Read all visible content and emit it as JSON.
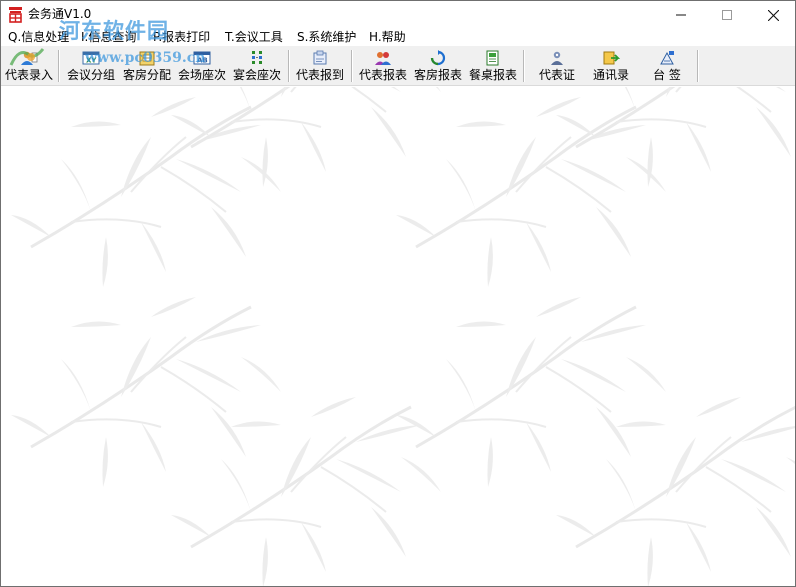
{
  "window": {
    "title": "会务通V1.0"
  },
  "watermark": {
    "name": "河东软件园",
    "url": "www.pc0359.cn"
  },
  "menu": [
    {
      "label": "Q.信息处理"
    },
    {
      "label": "I.信息查询"
    },
    {
      "label": "P.报表打印"
    },
    {
      "label": "T.会议工具"
    },
    {
      "label": "S.系统维护"
    },
    {
      "label": "H.帮助"
    }
  ],
  "toolbar": [
    {
      "label": "代表录入",
      "icon": "user-entry-icon"
    },
    {
      "label": "会议分组",
      "icon": "meeting-group-icon"
    },
    {
      "label": "客房分配",
      "icon": "room-allocation-icon"
    },
    {
      "label": "会场座次",
      "icon": "venue-seating-icon"
    },
    {
      "label": "宴会座次",
      "icon": "banquet-seating-icon"
    },
    {
      "label": "代表报到",
      "icon": "check-in-icon"
    },
    {
      "label": "代表报表",
      "icon": "delegate-report-icon"
    },
    {
      "label": "客房报表",
      "icon": "room-report-icon"
    },
    {
      "label": "餐桌报表",
      "icon": "table-report-icon"
    },
    {
      "label": "代表证",
      "icon": "badge-icon"
    },
    {
      "label": "通讯录",
      "icon": "address-book-icon"
    },
    {
      "label": "台  签",
      "icon": "table-card-icon"
    }
  ],
  "colors": {
    "accent": "#1e6fd0",
    "toolbar_bg": "#f0f0f0",
    "watermark": "#3894dc"
  }
}
